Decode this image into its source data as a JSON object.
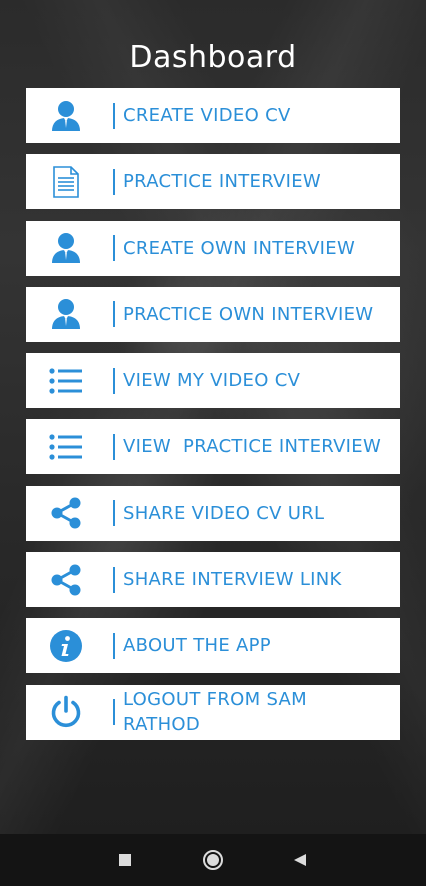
{
  "header": {
    "title": "Dashboard"
  },
  "menu": {
    "items": [
      {
        "label": "CREATE VIDEO CV",
        "icon": "user-icon"
      },
      {
        "label": "PRACTICE INTERVIEW",
        "icon": "document-icon"
      },
      {
        "label": "CREATE OWN INTERVIEW",
        "icon": "user-icon"
      },
      {
        "label": "PRACTICE OWN INTERVIEW",
        "icon": "user-icon"
      },
      {
        "label": "VIEW MY VIDEO CV",
        "icon": "list-icon"
      },
      {
        "label": "VIEW  PRACTICE INTERVIEW",
        "icon": "list-icon"
      },
      {
        "label": "SHARE VIDEO CV URL",
        "icon": "share-icon"
      },
      {
        "label": "SHARE INTERVIEW LINK",
        "icon": "share-icon"
      },
      {
        "label": "ABOUT THE APP",
        "icon": "info-icon"
      },
      {
        "label": "LOGOUT FROM SAM RATHOD",
        "icon": "power-icon"
      }
    ]
  },
  "navbar": {
    "buttons": [
      "recents-square-icon",
      "home-circle-icon",
      "back-triangle-icon"
    ]
  },
  "colors": {
    "accent": "#2b8fd8",
    "item_bg": "#ffffff",
    "navbar_bg": "#141414"
  }
}
